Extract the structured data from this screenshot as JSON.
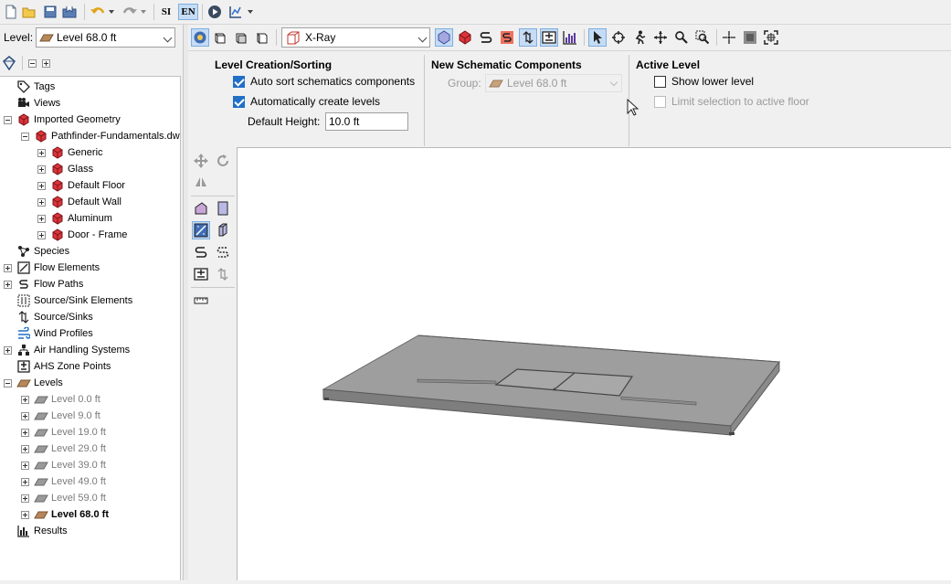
{
  "toolbar": {
    "icons": [
      "new-file-icon",
      "open-folder-icon",
      "save-icon",
      "save-as-icon",
      "undo-icon",
      "redo-icon",
      "run-icon",
      "results-icon"
    ],
    "lang_si": "SI",
    "lang_en": "EN"
  },
  "level_selector": {
    "label": "Level:",
    "value": "Level 68.0 ft"
  },
  "tree": {
    "items": [
      {
        "label": "Tags"
      },
      {
        "label": "Views"
      },
      {
        "label": "Imported Geometry"
      },
      {
        "label": "Pathfinder-Fundamentals.dw"
      },
      {
        "label": "Generic"
      },
      {
        "label": "Glass"
      },
      {
        "label": "Default Floor"
      },
      {
        "label": "Default Wall"
      },
      {
        "label": "Aluminum"
      },
      {
        "label": "Door - Frame"
      },
      {
        "label": "Species"
      },
      {
        "label": "Flow Elements"
      },
      {
        "label": "Flow Paths"
      },
      {
        "label": "Source/Sink Elements"
      },
      {
        "label": "Source/Sinks"
      },
      {
        "label": "Wind Profiles"
      },
      {
        "label": "Air Handling Systems"
      },
      {
        "label": "AHS Zone Points"
      },
      {
        "label": "Levels"
      },
      {
        "label": "Level 0.0 ft"
      },
      {
        "label": "Level 9.0 ft"
      },
      {
        "label": "Level 19.0 ft"
      },
      {
        "label": "Level 29.0 ft"
      },
      {
        "label": "Level 39.0 ft"
      },
      {
        "label": "Level 49.0 ft"
      },
      {
        "label": "Level 59.0 ft"
      },
      {
        "label": "Level 68.0 ft"
      },
      {
        "label": "Results"
      }
    ]
  },
  "view_toolbar": {
    "render_mode": "X-Ray"
  },
  "props": {
    "level_creation": {
      "title": "Level Creation/Sorting",
      "auto_sort_label": "Auto sort schematics components",
      "auto_sort_checked": true,
      "auto_create_label": "Automatically create levels",
      "auto_create_checked": true,
      "default_height_label": "Default Height:",
      "default_height_value": "10.0 ft"
    },
    "new_schematic": {
      "title": "New Schematic Components",
      "group_label": "Group:",
      "group_value": "Level 68.0 ft"
    },
    "active_level": {
      "title": "Active Level",
      "show_lower_label": "Show lower level",
      "show_lower_checked": false,
      "limit_selection_label": "Limit selection to active floor",
      "limit_selection_checked": false
    }
  },
  "colors": {
    "accent": "#1f6fc8",
    "geometry_red": "#d9353b",
    "floor_brown": "#b5875a"
  }
}
